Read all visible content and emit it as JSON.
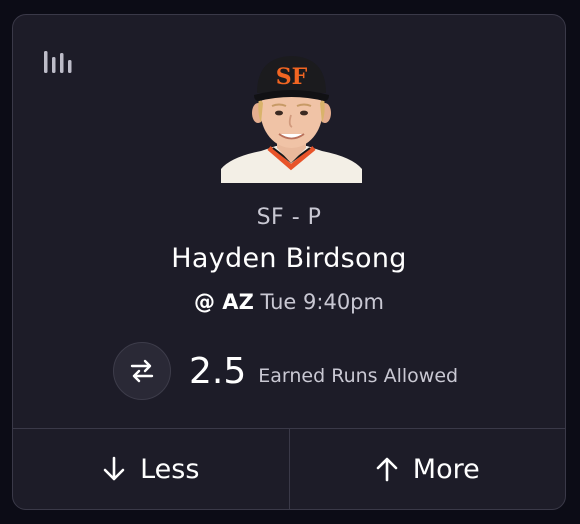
{
  "card": {
    "icons": {
      "stats": "bar-chart-icon",
      "swap": "swap-arrows-icon",
      "less": "arrow-down-icon",
      "more": "arrow-up-icon"
    },
    "player": {
      "team_position": "SF - P",
      "name": "Hayden Birdsong",
      "opponent": "@ AZ",
      "game_time": "Tue 9:40pm"
    },
    "projection": {
      "line": "2.5",
      "stat": "Earned Runs Allowed"
    },
    "actions": {
      "less_label": "Less",
      "more_label": "More"
    },
    "colors": {
      "background": "#0c0c16",
      "card": "#1d1c28",
      "border": "#3a3948",
      "secondary_text": "#c9c8d3",
      "cap_logo": "#f26522"
    }
  }
}
